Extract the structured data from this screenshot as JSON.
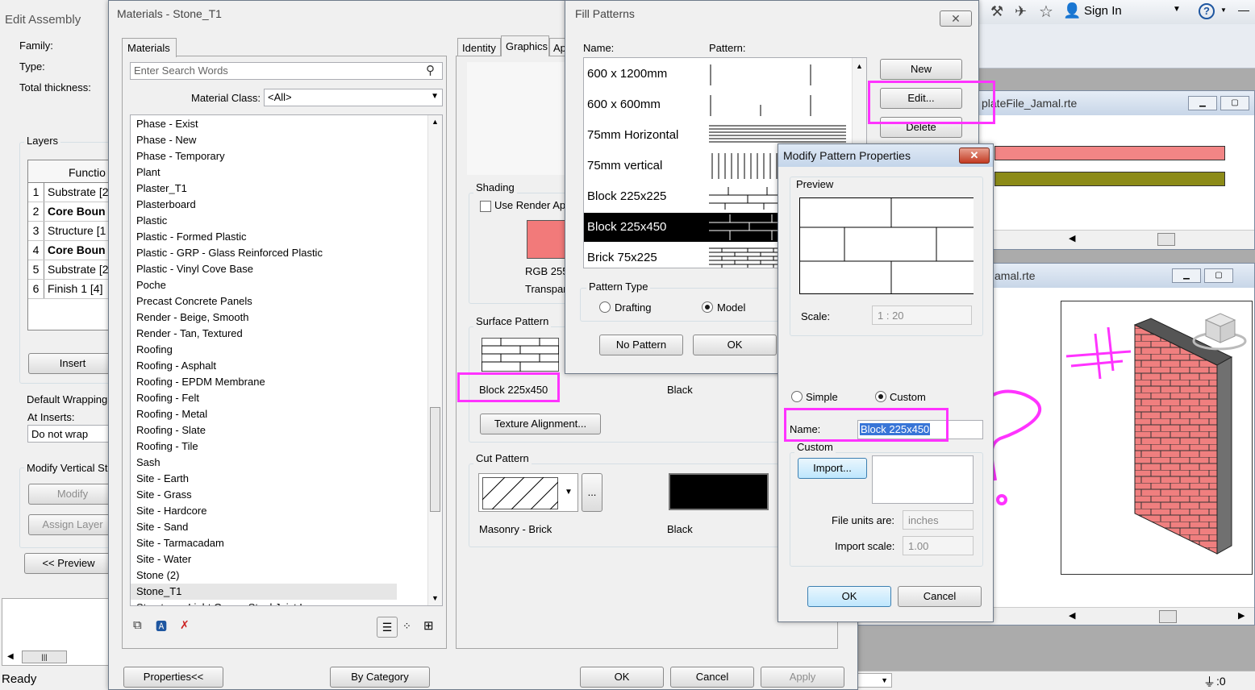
{
  "edit_assembly": {
    "title": "Edit Assembly",
    "family_label": "Family:",
    "type_label": "Type:",
    "thickness_label": "Total thickness:",
    "layers_label": "Layers",
    "function_header": "Functio",
    "rows": [
      {
        "num": "1",
        "text": "Substrate [2",
        "bold": false
      },
      {
        "num": "2",
        "text": "Core Boun",
        "bold": true
      },
      {
        "num": "3",
        "text": "Structure [1",
        "bold": false
      },
      {
        "num": "4",
        "text": "Core Boun",
        "bold": true
      },
      {
        "num": "5",
        "text": "Substrate [2",
        "bold": false
      },
      {
        "num": "6",
        "text": "Finish 1 [4]",
        "bold": false
      }
    ],
    "insert_label": "Insert",
    "default_wrapping_label": "Default Wrapping",
    "at_inserts_label": "At Inserts:",
    "wrap_value": "Do not wrap",
    "modify_vertical_label": "Modify Vertical St",
    "modify_label": "Modify",
    "assign_layer_label": "Assign Layer",
    "preview_label": "<< Preview"
  },
  "statusbar": {
    "ready": "Ready",
    "filter": ":0"
  },
  "materials": {
    "title": "Materials - Stone_T1",
    "tab_materials": "Materials",
    "search_placeholder": "Enter Search Words",
    "material_class_label": "Material Class:",
    "material_class_value": "<All>",
    "items": [
      "Phase - Exist",
      "Phase - New",
      "Phase - Temporary",
      "Plant",
      "Plaster_T1",
      "Plasterboard",
      "Plastic",
      "Plastic - Formed Plastic",
      "Plastic - GRP - Glass Reinforced Plastic",
      "Plastic - Vinyl Cove Base",
      "Poche",
      "Precast Concrete Panels",
      "Render - Beige, Smooth",
      "Render - Tan, Textured",
      "Roofing",
      "Roofing - Asphalt",
      "Roofing - EPDM Membrane",
      "Roofing - Felt",
      "Roofing - Metal",
      "Roofing - Slate",
      "Roofing - Tile",
      "Sash",
      "Site - Earth",
      "Site - Grass",
      "Site - Hardcore",
      "Site - Sand",
      "Site - Tarmacadam",
      "Site - Water",
      "Stone (2)",
      "Stone_T1",
      "Structure - Light Gauge Steel Joist Layer"
    ],
    "selected_index": 29,
    "tabs": [
      "Identity",
      "Graphics",
      "Ap"
    ],
    "shading_label": "Shading",
    "use_render_label": "Use Render App",
    "rgb_label": "RGB 255-",
    "transparency_label": "Transpar",
    "shade_color": "#f27a7a",
    "surface_pattern_label": "Surface Pattern",
    "surface_pattern_name": "Block 225x450",
    "surface_color_name": "Black",
    "texture_alignment_label": "Texture Alignment...",
    "cut_pattern_label": "Cut Pattern",
    "cut_pattern_name": "Masonry - Brick",
    "cut_color_name": "Black",
    "more_label": "...",
    "properties_label": "Properties<<",
    "by_category_label": "By Category",
    "ok_label": "OK",
    "cancel_label": "Cancel",
    "apply_label": "Apply"
  },
  "fill_patterns": {
    "title": "Fill Patterns",
    "name_header": "Name:",
    "pattern_header": "Pattern:",
    "rows": [
      "600 x 1200mm",
      "600 x 600mm",
      "75mm Horizontal",
      "75mm vertical",
      "Block 225x225",
      "Block 225x450",
      "Brick 75x225"
    ],
    "selected_index": 5,
    "new_label": "New",
    "edit_label": "Edit...",
    "delete_label": "Delete",
    "pattern_type_label": "Pattern Type",
    "drafting_label": "Drafting",
    "model_label": "Model",
    "no_pattern_label": "No Pattern",
    "ok_label": "OK"
  },
  "modify_pattern": {
    "title": "Modify Pattern Properties",
    "preview_label": "Preview",
    "scale_label": "Scale:",
    "scale_value": "1 : 20",
    "simple_label": "Simple",
    "custom_label": "Custom",
    "name_label": "Name:",
    "name_value": "Block 225x450",
    "custom_group_label": "Custom",
    "import_label": "Import...",
    "file_units_label": "File units are:",
    "file_units_value": "inches",
    "import_scale_label": "Import scale:",
    "import_scale_value": "1.00",
    "ok_label": "OK",
    "cancel_label": "Cancel"
  },
  "revit": {
    "sign_in": "Sign In",
    "view1_title": "plateFile_Jamal.rte",
    "view2_title": "amal.rte"
  },
  "colors": {
    "highlight": "#ff33ff",
    "brick": "#f07f7f",
    "selection": "#000000"
  }
}
